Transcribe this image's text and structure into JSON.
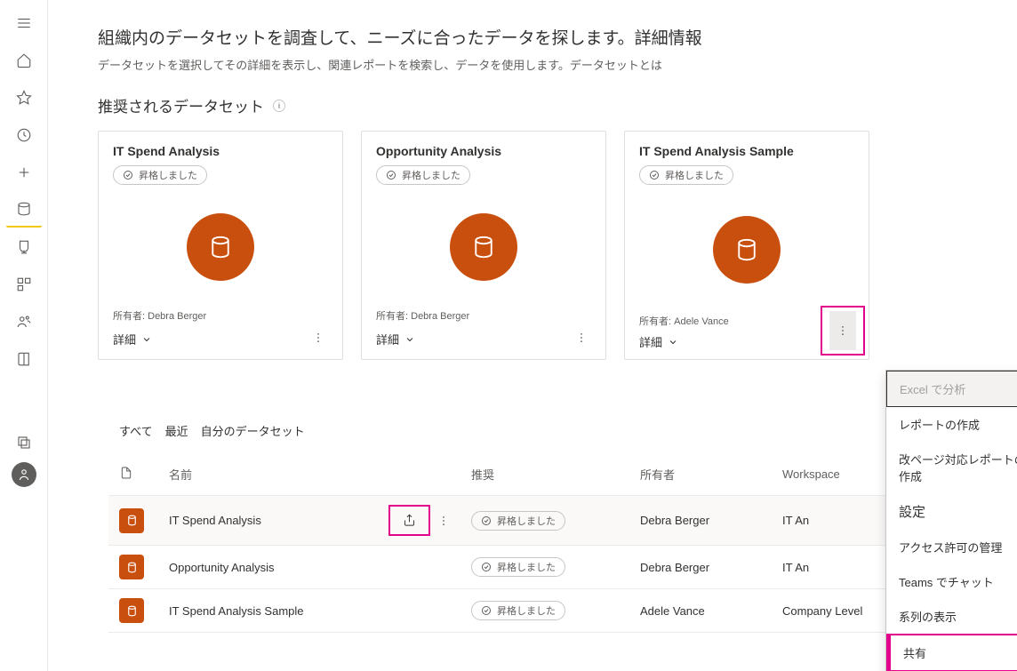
{
  "page": {
    "title": "組織内のデータセットを調査して、ニーズに合ったデータを探します。詳細情報",
    "subtitle": "データセットを選択してその詳細を表示し、関連レポートを検索し、データを使用します。データセットとは"
  },
  "section": {
    "recommended": "推奨されるデータセット"
  },
  "labels": {
    "promoted": "昇格しました",
    "owner_prefix": "所有者:",
    "details": "詳細"
  },
  "cards": [
    {
      "title": "IT Spend Analysis",
      "owner": "Debra Berger"
    },
    {
      "title": "Opportunity Analysis",
      "owner": "Debra Berger"
    },
    {
      "title": "IT Spend Analysis Sample",
      "owner": "Adele Vance"
    }
  ],
  "context_menu": {
    "analyze_excel": "Excel で分析",
    "create_report": "レポートの作成",
    "create_paginated": "改ページ対応レポートの作成",
    "settings": "設定",
    "manage_permissions": "アクセス許可の管理",
    "teams_chat": "Teams でチャット",
    "view_lineage": "系列の表示",
    "share": "共有"
  },
  "tabs": {
    "all": "すべて",
    "recent": "最近",
    "my": "自分のデータセット"
  },
  "table": {
    "columns": {
      "name": "名前",
      "recommend": "推奨",
      "owner": "所有者",
      "workspace": "Workspace"
    },
    "rows": [
      {
        "name": "IT Spend Analysis",
        "owner": "Debra Berger",
        "workspace": "IT An"
      },
      {
        "name": "Opportunity Analysis",
        "owner": "Debra Berger",
        "workspace": "IT An"
      },
      {
        "name": "IT Spend Analysis Sample",
        "owner": "Adele Vance",
        "workspace": "Company Level"
      }
    ]
  }
}
